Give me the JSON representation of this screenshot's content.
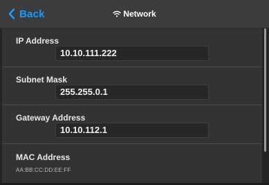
{
  "header": {
    "back_label": "Back",
    "title": "Network",
    "back_icon": "chevron-left-icon",
    "title_icon": "wifi-icon",
    "accent_color": "#1e9bff"
  },
  "sections": {
    "ip": {
      "label": "IP Address",
      "value": "10.10.111.222"
    },
    "subnet": {
      "label": "Subnet Mask",
      "value": "255.255.0.1"
    },
    "gateway": {
      "label": "Gateway Address",
      "value": "10.10.112.1"
    },
    "mac": {
      "label": "MAC Address",
      "value": "AA:BB:CC:DD:EE:FF"
    }
  }
}
